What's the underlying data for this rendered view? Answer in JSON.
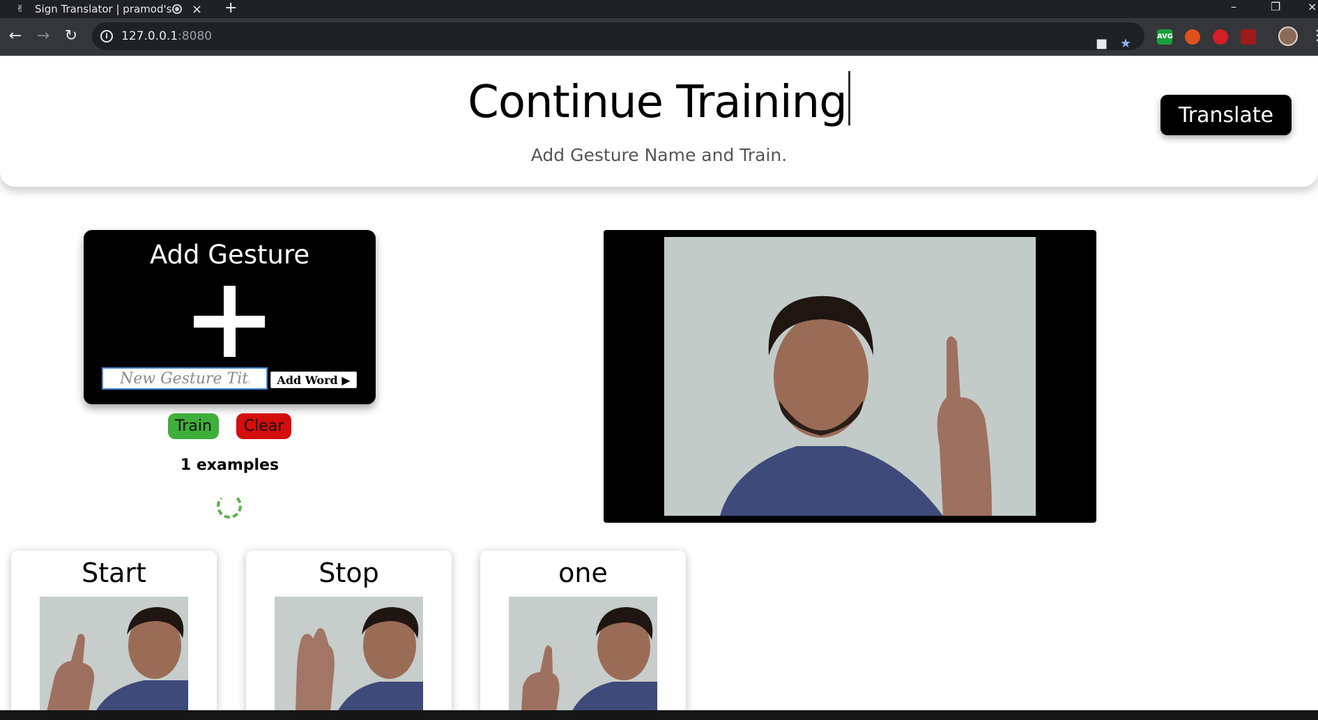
{
  "browser": {
    "tab_title": "Sign Translator | pramod's",
    "new_tab": "+",
    "url_host": "127.0.0.1",
    "url_port": ":8080",
    "extensions": [
      "AVG",
      "fire",
      "stop",
      "pdf"
    ]
  },
  "header": {
    "title": "Continue Training",
    "subtitle": "Add Gesture Name and Train.",
    "translate_label": "Translate"
  },
  "add_gesture": {
    "title": "Add Gesture",
    "input_placeholder": "New Gesture Title",
    "add_word_label": "Add Word ▶"
  },
  "training": {
    "train_label": "Train",
    "clear_label": "Clear",
    "examples_text": "1 examples"
  },
  "gestures": [
    {
      "name": "Start"
    },
    {
      "name": "Stop"
    },
    {
      "name": "one"
    }
  ],
  "colors": {
    "train": "#3fae3a",
    "clear": "#d40d0d",
    "spinner": "#58b24a"
  }
}
